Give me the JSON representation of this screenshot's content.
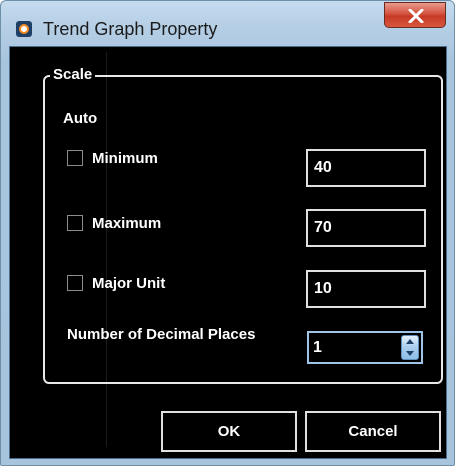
{
  "window": {
    "title": "Trend Graph Property",
    "close_icon": "close-x-icon",
    "app_icon": "app-logo-icon"
  },
  "scale": {
    "group_label": "Scale",
    "auto_label": "Auto",
    "minimum": {
      "label": "Minimum",
      "checked": false,
      "value": "40"
    },
    "maximum": {
      "label": "Maximum",
      "checked": false,
      "value": "70"
    },
    "major_unit": {
      "label": "Major Unit",
      "checked": false,
      "value": "10"
    },
    "decimal_places": {
      "label": "Number of Decimal Places",
      "value": "1"
    }
  },
  "buttons": {
    "ok": "OK",
    "cancel": "Cancel"
  },
  "colors": {
    "titlebar": "#b3cde4",
    "client_background": "#000000",
    "text": "#ffffff",
    "close_button": "#c63a25",
    "spinner_accent": "#9ec4e8"
  }
}
